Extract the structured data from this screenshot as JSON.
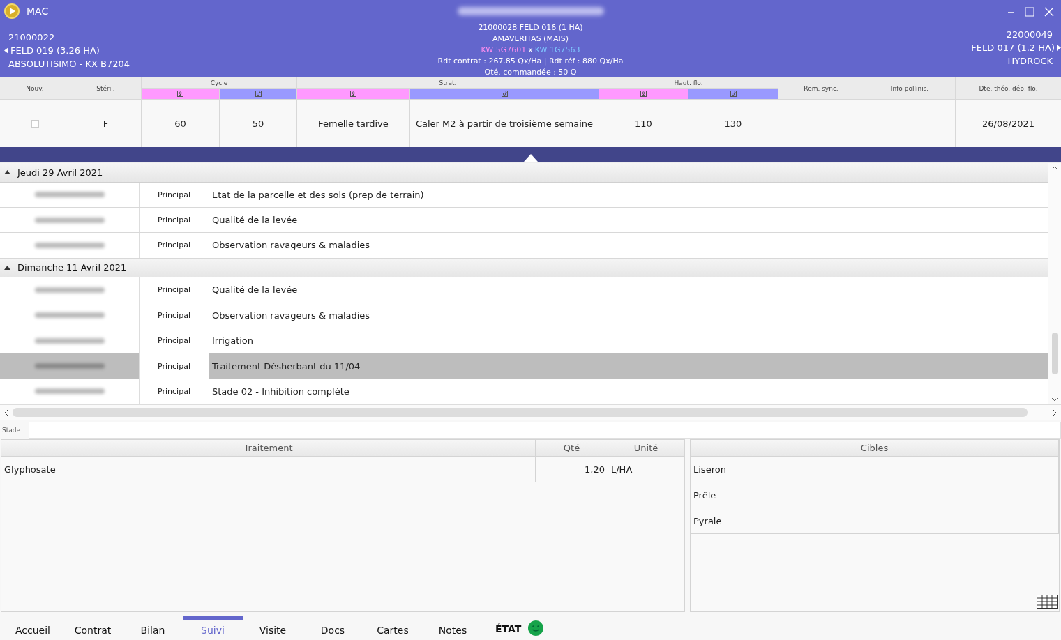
{
  "header": {
    "app_name": "MAC",
    "left": {
      "code": "21000022",
      "field": "FELD 019 (3.26 HA)",
      "variety": "ABSOLUTISIMO - KX B7204"
    },
    "center": {
      "field": "21000028 FELD 016 (1 HA)",
      "variety": "AMAVERITAS (MAIS)",
      "female": "KW 5G7601",
      "cross": "x",
      "male": "KW 1G7563",
      "yield": "Rdt contrat : 267.85 Qx/Ha | Rdt réf : 880 Qx/Ha",
      "ordered": "Qté. commandée : 50 Q"
    },
    "right": {
      "code": "22000049",
      "field": "FELD 017 (1.2 HA)",
      "variety": "HYDROCK"
    }
  },
  "grid": {
    "columns": [
      {
        "kind": "single",
        "label": "Nouv."
      },
      {
        "kind": "single",
        "label": "Stéril."
      },
      {
        "kind": "group",
        "label": "Cycle",
        "subs": [
          {
            "kind": "female",
            "color": "#ff99ff"
          },
          {
            "kind": "male",
            "color": "#9999ff"
          }
        ]
      },
      {
        "kind": "group",
        "label": "Strat.",
        "subs": [
          {
            "kind": "female",
            "color": "#ff99ff"
          },
          {
            "kind": "male",
            "color": "#9999ff"
          }
        ]
      },
      {
        "kind": "group",
        "label": "Haut. flo.",
        "subs": [
          {
            "kind": "female",
            "color": "#ff99ff"
          },
          {
            "kind": "male",
            "color": "#9999ff"
          }
        ]
      },
      {
        "kind": "single",
        "label": "Rem. sync."
      },
      {
        "kind": "single",
        "label": "Info pollinis."
      },
      {
        "kind": "single",
        "label": "Dte. théo. déb. flo."
      }
    ],
    "row": [
      {
        "kind": "checkbox",
        "checked": false
      },
      {
        "kind": "text",
        "text": "F"
      },
      {
        "kind": "text",
        "text": "60"
      },
      {
        "kind": "text",
        "text": "50"
      },
      {
        "kind": "text",
        "text": "Femelle tardive"
      },
      {
        "kind": "text",
        "text": "Caler M2 à partir de troisième semaine"
      },
      {
        "kind": "text",
        "text": "110"
      },
      {
        "kind": "text",
        "text": "130"
      },
      {
        "kind": "empty"
      },
      {
        "kind": "empty"
      },
      {
        "kind": "text",
        "text": "26/08/2021"
      }
    ]
  },
  "groups": [
    {
      "date": "Jeudi 29 Avril 2021",
      "expanded": true,
      "rows": [
        {
          "type": "Principal",
          "label": "Etat de la parcelle et des sols (prep de terrain)",
          "selected": false
        },
        {
          "type": "Principal",
          "label": "Qualité de la levée",
          "selected": false
        },
        {
          "type": "Principal",
          "label": "Observation ravageurs & maladies",
          "selected": false
        }
      ]
    },
    {
      "date": "Dimanche 11 Avril 2021",
      "expanded": true,
      "rows": [
        {
          "type": "Principal",
          "label": "Qualité de la levée",
          "selected": false
        },
        {
          "type": "Principal",
          "label": "Observation ravageurs & maladies",
          "selected": false
        },
        {
          "type": "Principal",
          "label": "Irrigation",
          "selected": false
        },
        {
          "type": "Principal",
          "label": "Traitement Désherbant du 11/04",
          "selected": true
        },
        {
          "type": "Principal",
          "label": "Stade 02 - Inhibition complète",
          "selected": false
        }
      ]
    }
  ],
  "stade": {
    "label": "Stade"
  },
  "treatment": {
    "columns": [
      "Traitement",
      "Qté",
      "Unité"
    ],
    "rows": [
      {
        "name": "Glyphosate",
        "qty": "1,20",
        "unit": "L/HA"
      }
    ]
  },
  "targets": {
    "title": "Cibles",
    "items": [
      "Liseron",
      "Prêle",
      "Pyrale"
    ]
  },
  "tabs": [
    {
      "label": "Accueil",
      "selected": false
    },
    {
      "label": "Contrat",
      "selected": false
    },
    {
      "label": "Bilan",
      "selected": false
    },
    {
      "label": "Suivi",
      "selected": true
    },
    {
      "label": "Visite",
      "selected": false
    },
    {
      "label": "Docs",
      "selected": false
    },
    {
      "label": "Cartes",
      "selected": false
    },
    {
      "label": "Notes",
      "selected": false
    }
  ],
  "status": {
    "label": "ÉTAT"
  }
}
